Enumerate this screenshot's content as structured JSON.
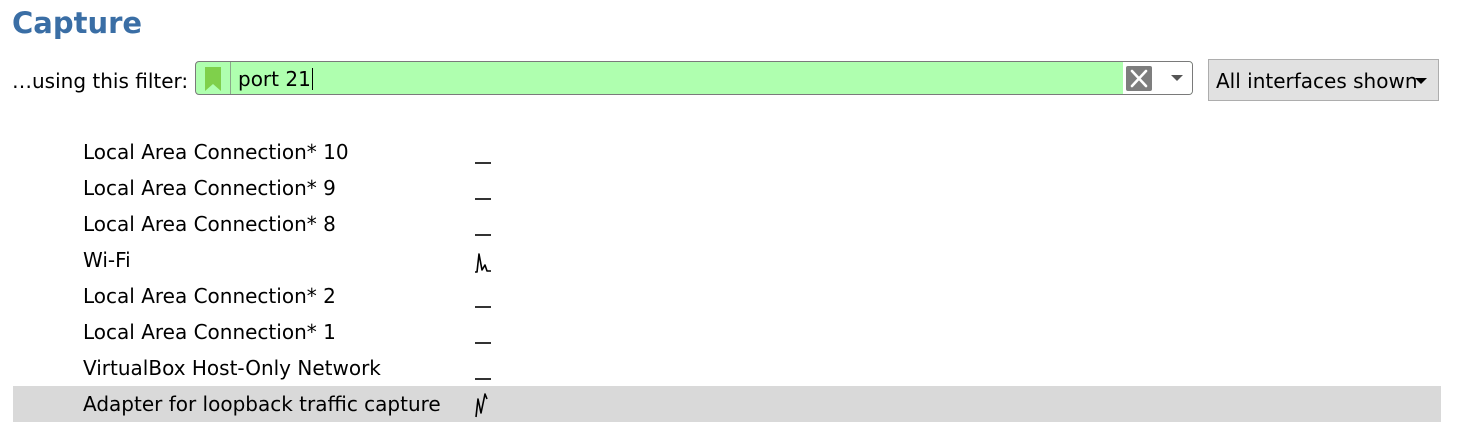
{
  "page": {
    "title": "Capture"
  },
  "filter": {
    "label": "…using this filter:",
    "value": "port 21",
    "state_color": "#afffaf",
    "bookmark_icon": "bookmark-icon",
    "clear_icon": "clear-icon",
    "dropdown_icon": "chevron-down-icon"
  },
  "interfaces_button": {
    "label": "All interfaces shown"
  },
  "interfaces": [
    {
      "name": "Local Area Connection* 10",
      "activity": "flat",
      "selected": false
    },
    {
      "name": "Local Area Connection* 9",
      "activity": "flat",
      "selected": false
    },
    {
      "name": "Local Area Connection* 8",
      "activity": "flat",
      "selected": false
    },
    {
      "name": "Wi-Fi",
      "activity": "spike",
      "selected": false
    },
    {
      "name": "Local Area Connection* 2",
      "activity": "flat",
      "selected": false
    },
    {
      "name": "Local Area Connection* 1",
      "activity": "flat",
      "selected": false
    },
    {
      "name": "VirtualBox Host-Only Network",
      "activity": "flat",
      "selected": false
    },
    {
      "name": "Adapter for loopback traffic capture",
      "activity": "zigzag",
      "selected": true
    }
  ],
  "colors": {
    "title": "#3a6ea5",
    "selected_row": "#d9d9d9",
    "bookmark": "#7fd04b"
  }
}
